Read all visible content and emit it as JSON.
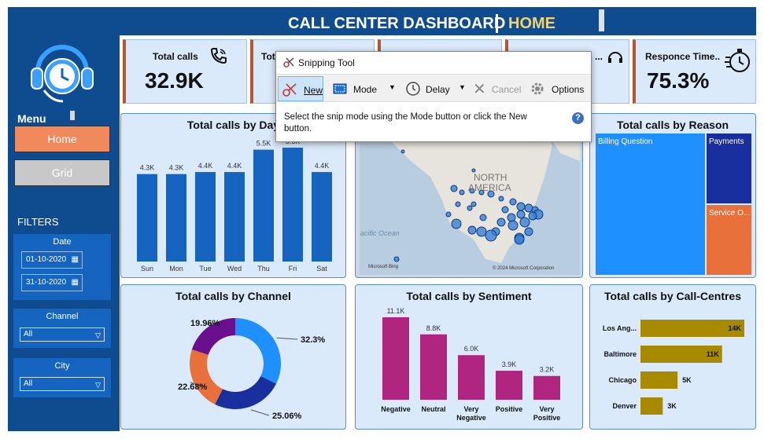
{
  "header": {
    "title": "CALL CENTER DASHBOARD",
    "page": "HOME"
  },
  "sidebar": {
    "menu_label": "Menu",
    "home_btn": "Home",
    "grid_btn": "Grid",
    "filters_label": "FILTERS",
    "date_label": "Date",
    "date_from": "01-10-2020",
    "date_to": "31-10-2020",
    "channel_label": "Channel",
    "channel_value": "All",
    "city_label": "City",
    "city_value": "All"
  },
  "kpis": [
    {
      "label": "Total calls",
      "value": "32.9K"
    },
    {
      "label": "Tota"
    },
    {
      "label": ""
    },
    {
      "label": ""
    },
    {
      "label": "Responce Time..",
      "value": "75.3%"
    }
  ],
  "kpi_partial": {
    "k4_tail": "..."
  },
  "snipping_tool": {
    "title": "Snipping Tool",
    "new": "New",
    "mode": "Mode",
    "delay": "Delay",
    "cancel": "Cancel",
    "options": "Options",
    "message": "Select the snip mode using the Mode button or click the New button."
  },
  "map": {
    "north_america": "NORTH\nAMERICA",
    "north": "NORTH",
    "america": "AMERICA",
    "ocean": "acific Ocean",
    "bing": "Microsoft Bing",
    "copyright": "© 2024 Microsoft Corporation"
  },
  "chart_data": [
    {
      "type": "bar",
      "title": "Total calls by Day",
      "categories": [
        "Sun",
        "Mon",
        "Tue",
        "Wed",
        "Thu",
        "Fri",
        "Sat"
      ],
      "values": [
        4.3,
        4.3,
        4.4,
        4.4,
        5.5,
        5.6,
        4.4
      ],
      "data_labels": [
        "4.3K",
        "4.3K",
        "4.4K",
        "4.4K",
        "5.5K",
        "5.6K",
        "4.4K"
      ],
      "color": "#1565c0"
    },
    {
      "type": "treemap",
      "title": "Total calls by Reason",
      "categories": [
        "Billing Question",
        "Payments",
        "Service O..."
      ],
      "colors": [
        "#1e90ff",
        "#1a2f9e",
        "#e8703a"
      ]
    },
    {
      "type": "pie",
      "title": "Total calls by Channel",
      "values": [
        32.3,
        25.06,
        22.68,
        19.96
      ],
      "data_labels": [
        "32.3%",
        "25.06%",
        "22.68%",
        "19.96%"
      ],
      "colors": [
        "#1e90ff",
        "#1a2f9e",
        "#e8703a",
        "#6a0f8e"
      ]
    },
    {
      "type": "bar",
      "title": "Total calls by Sentiment",
      "categories": [
        "Negative",
        "Neutral",
        "Very Negative",
        "Positive",
        "Very Positive"
      ],
      "values": [
        11.1,
        8.8,
        6.0,
        3.9,
        3.2
      ],
      "data_labels": [
        "11.1K",
        "8.8K",
        "6.0K",
        "3.9K",
        "3.2K"
      ],
      "color": "#b0257f"
    },
    {
      "type": "bar",
      "title": "Total calls by Call-Centres",
      "categories": [
        "Los Ang...",
        "Baltimore",
        "Chicago",
        "Denver"
      ],
      "values": [
        14,
        11,
        5,
        3
      ],
      "data_labels": [
        "14K",
        "11K",
        "5K",
        "3K"
      ],
      "color": "#a88a00"
    }
  ]
}
